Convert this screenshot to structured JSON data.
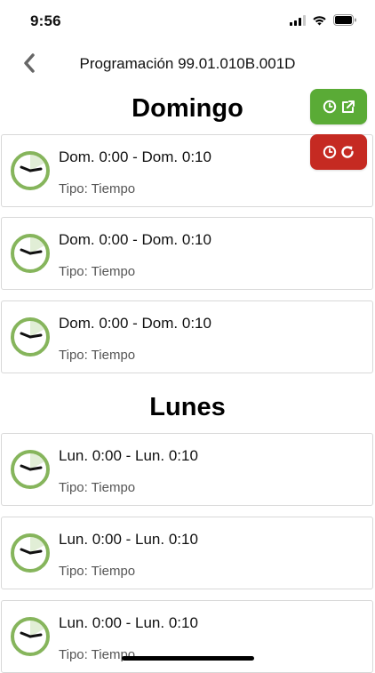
{
  "status": {
    "time": "9:56"
  },
  "nav": {
    "title": "Programación 99.01.010B.001D"
  },
  "actions": {
    "primary_icon": "clock-external-link-icon",
    "primary_color": "#5aab36",
    "secondary_icon": "clock-refresh-icon",
    "secondary_color": "#c52a22"
  },
  "sections": [
    {
      "heading": "Domingo",
      "items": [
        {
          "range": "Dom. 0:00 - Dom. 0:10",
          "type": "Tipo: Tiempo",
          "progress": 0.17
        },
        {
          "range": "Dom. 0:00 - Dom. 0:10",
          "type": "Tipo: Tiempo",
          "progress": 0.17
        },
        {
          "range": "Dom. 0:00 - Dom. 0:10",
          "type": "Tipo: Tiempo",
          "progress": 0.17
        }
      ]
    },
    {
      "heading": "Lunes",
      "items": [
        {
          "range": "Lun. 0:00 - Lun. 0:10",
          "type": "Tipo: Tiempo",
          "progress": 0.17
        },
        {
          "range": "Lun. 0:00 - Lun. 0:10",
          "type": "Tipo: Tiempo",
          "progress": 0.17
        },
        {
          "range": "Lun. 0:00 - Lun. 0:10",
          "type": "Tipo: Tiempo",
          "progress": 0.17
        }
      ]
    }
  ]
}
